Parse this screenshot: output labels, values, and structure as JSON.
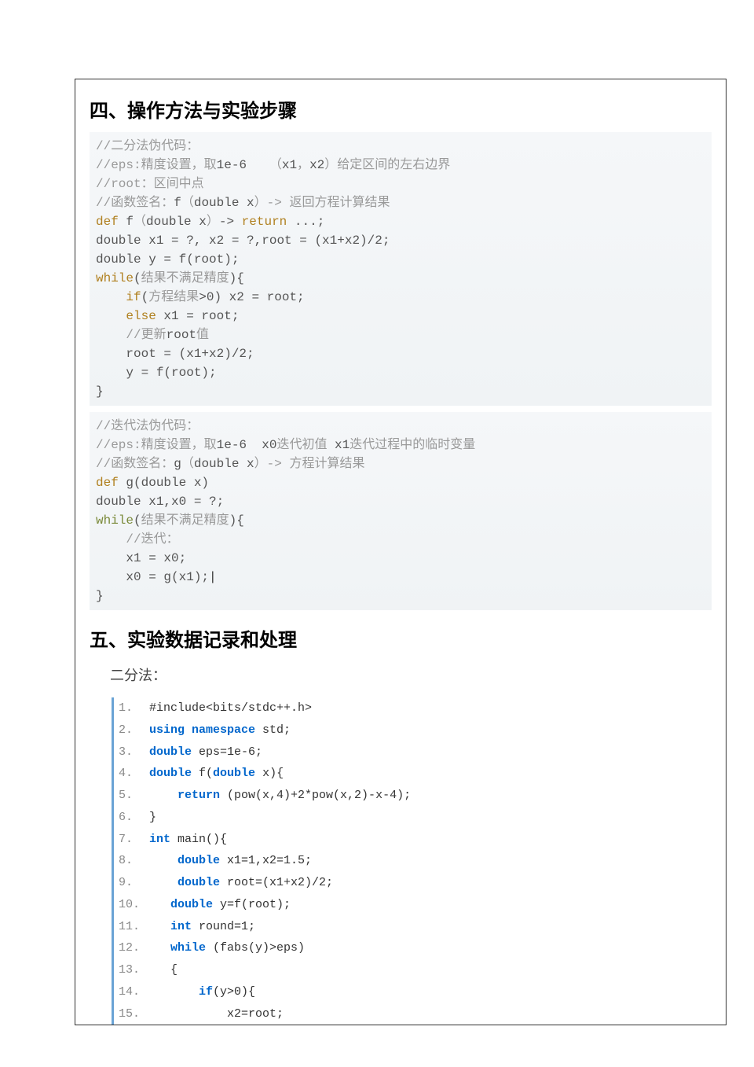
{
  "section4": {
    "heading": "四、操作方法与实验步骤",
    "codeBlock1": [
      {
        "t": "comment",
        "text": "//二分法伪代码："
      },
      {
        "t": "mixed",
        "parts": [
          {
            "c": "comment",
            "s": "//eps:精度设置，取"
          },
          {
            "c": "plain",
            "s": "1e-6"
          },
          {
            "c": "comment",
            "s": "   （"
          },
          {
            "c": "plain",
            "s": "x1"
          },
          {
            "c": "comment",
            "s": "，"
          },
          {
            "c": "plain",
            "s": "x2"
          },
          {
            "c": "comment",
            "s": "）给定区间的左右边界"
          }
        ]
      },
      {
        "t": "mixed",
        "parts": [
          {
            "c": "comment",
            "s": "//root"
          },
          {
            "c": "comment",
            "s": "：区间中点"
          }
        ]
      },
      {
        "t": "mixed",
        "parts": [
          {
            "c": "comment",
            "s": "//函数签名："
          },
          {
            "c": "plain",
            "s": "f"
          },
          {
            "c": "comment",
            "s": "（"
          },
          {
            "c": "plain",
            "s": "double x"
          },
          {
            "c": "comment",
            "s": "）-> 返回方程计算结果"
          }
        ]
      },
      {
        "t": "mixed",
        "parts": [
          {
            "c": "keyword",
            "s": "def "
          },
          {
            "c": "plain",
            "s": "f"
          },
          {
            "c": "comment",
            "s": "（"
          },
          {
            "c": "plain",
            "s": "double x"
          },
          {
            "c": "comment",
            "s": "）"
          },
          {
            "c": "plain",
            "s": "-> "
          },
          {
            "c": "keyword",
            "s": "return "
          },
          {
            "c": "plain",
            "s": "...;"
          }
        ]
      },
      {
        "t": "mixed",
        "parts": [
          {
            "c": "plain",
            "s": "double x1 = ?, x2 = ?,root = (x1+x2)/2;"
          }
        ]
      },
      {
        "t": "mixed",
        "parts": [
          {
            "c": "plain",
            "s": "double y = f(root);"
          }
        ]
      },
      {
        "t": "mixed",
        "parts": [
          {
            "c": "keyword",
            "s": "while"
          },
          {
            "c": "plain",
            "s": "("
          },
          {
            "c": "comment",
            "s": "结果不满足精度"
          },
          {
            "c": "plain",
            "s": "){"
          }
        ]
      },
      {
        "t": "mixed",
        "parts": [
          {
            "c": "plain",
            "s": "    "
          },
          {
            "c": "keyword",
            "s": "if"
          },
          {
            "c": "plain",
            "s": "("
          },
          {
            "c": "comment",
            "s": "方程结果"
          },
          {
            "c": "plain",
            "s": ">0) x2 = root;"
          }
        ]
      },
      {
        "t": "mixed",
        "parts": [
          {
            "c": "plain",
            "s": "    "
          },
          {
            "c": "keyword",
            "s": "else"
          },
          {
            "c": "plain",
            "s": " x1 = root;"
          }
        ]
      },
      {
        "t": "mixed",
        "parts": [
          {
            "c": "plain",
            "s": "    "
          },
          {
            "c": "comment",
            "s": "//更新"
          },
          {
            "c": "plain",
            "s": "root"
          },
          {
            "c": "comment",
            "s": "值"
          }
        ]
      },
      {
        "t": "mixed",
        "parts": [
          {
            "c": "plain",
            "s": "    root = (x1+x2)/2;"
          }
        ]
      },
      {
        "t": "mixed",
        "parts": [
          {
            "c": "plain",
            "s": "    y = f(root);"
          }
        ]
      },
      {
        "t": "mixed",
        "parts": [
          {
            "c": "plain",
            "s": "}"
          }
        ]
      }
    ],
    "codeBlock2": [
      {
        "t": "comment",
        "text": "//迭代法伪代码："
      },
      {
        "t": "mixed",
        "parts": [
          {
            "c": "comment",
            "s": "//eps:精度设置，取"
          },
          {
            "c": "plain",
            "s": "1e-6  x0"
          },
          {
            "c": "comment",
            "s": "迭代初值 "
          },
          {
            "c": "plain",
            "s": "x1"
          },
          {
            "c": "comment",
            "s": "迭代过程中的临时变量"
          }
        ]
      },
      {
        "t": "mixed",
        "parts": [
          {
            "c": "comment",
            "s": "//函数签名："
          },
          {
            "c": "plain",
            "s": "g"
          },
          {
            "c": "comment",
            "s": "（"
          },
          {
            "c": "plain",
            "s": "double x"
          },
          {
            "c": "comment",
            "s": "）-> 方程计算结果"
          }
        ]
      },
      {
        "t": "mixed",
        "parts": [
          {
            "c": "keyword",
            "s": "def "
          },
          {
            "c": "plain",
            "s": "g(double x)"
          }
        ]
      },
      {
        "t": "mixed",
        "parts": [
          {
            "c": "plain",
            "s": "double x1,x0 = ?;"
          }
        ]
      },
      {
        "t": "mixed",
        "parts": [
          {
            "c": "keyword2",
            "s": "while"
          },
          {
            "c": "plain",
            "s": "("
          },
          {
            "c": "comment",
            "s": "结果不满足精度"
          },
          {
            "c": "plain",
            "s": "){"
          }
        ]
      },
      {
        "t": "mixed",
        "parts": [
          {
            "c": "plain",
            "s": "    "
          },
          {
            "c": "comment",
            "s": "//迭代："
          }
        ]
      },
      {
        "t": "mixed",
        "parts": [
          {
            "c": "plain",
            "s": "    x1 = x0;"
          }
        ]
      },
      {
        "t": "mixed",
        "parts": [
          {
            "c": "plain",
            "s": "    x0 = g(x1);"
          },
          {
            "c": "cursor",
            "s": "|"
          }
        ]
      },
      {
        "t": "mixed",
        "parts": [
          {
            "c": "plain",
            "s": "}"
          }
        ]
      }
    ]
  },
  "section5": {
    "heading": "五、实验数据记录和处理",
    "subLabel": "二分法：",
    "codeLines": [
      {
        "num": "1.",
        "parts": [
          {
            "c": "plain",
            "s": " #include<bits/stdc++.h>"
          }
        ]
      },
      {
        "num": "2.",
        "parts": [
          {
            "c": "plain",
            "s": " "
          },
          {
            "c": "kw-blue",
            "s": "using namespace"
          },
          {
            "c": "plain",
            "s": " std;"
          }
        ]
      },
      {
        "num": "3.",
        "parts": [
          {
            "c": "plain",
            "s": " "
          },
          {
            "c": "kw-blue",
            "s": "double"
          },
          {
            "c": "plain",
            "s": " eps=1e-6;"
          }
        ]
      },
      {
        "num": "4.",
        "parts": [
          {
            "c": "plain",
            "s": " "
          },
          {
            "c": "kw-blue",
            "s": "double"
          },
          {
            "c": "plain",
            "s": " f("
          },
          {
            "c": "kw-blue",
            "s": "double"
          },
          {
            "c": "plain",
            "s": " x){"
          }
        ]
      },
      {
        "num": "5.",
        "parts": [
          {
            "c": "plain",
            "s": "     "
          },
          {
            "c": "kw-blue",
            "s": "return"
          },
          {
            "c": "plain",
            "s": " (pow(x,4)+2*pow(x,2)-x-4);"
          }
        ]
      },
      {
        "num": "6.",
        "parts": [
          {
            "c": "plain",
            "s": " }"
          }
        ]
      },
      {
        "num": "7.",
        "parts": [
          {
            "c": "plain",
            "s": " "
          },
          {
            "c": "kw-blue",
            "s": "int"
          },
          {
            "c": "plain",
            "s": " main(){"
          }
        ]
      },
      {
        "num": "8.",
        "parts": [
          {
            "c": "plain",
            "s": "     "
          },
          {
            "c": "kw-blue",
            "s": "double"
          },
          {
            "c": "plain",
            "s": " x1=1,x2=1.5;"
          }
        ]
      },
      {
        "num": "9.",
        "parts": [
          {
            "c": "plain",
            "s": "     "
          },
          {
            "c": "kw-blue",
            "s": "double"
          },
          {
            "c": "plain",
            "s": " root=(x1+x2)/2;"
          }
        ]
      },
      {
        "num": "10.",
        "parts": [
          {
            "c": "plain",
            "s": "    "
          },
          {
            "c": "kw-blue",
            "s": "double"
          },
          {
            "c": "plain",
            "s": " y=f(root);"
          }
        ]
      },
      {
        "num": "11.",
        "parts": [
          {
            "c": "plain",
            "s": "    "
          },
          {
            "c": "kw-blue",
            "s": "int"
          },
          {
            "c": "plain",
            "s": " round=1;"
          }
        ]
      },
      {
        "num": "12.",
        "parts": [
          {
            "c": "plain",
            "s": "    "
          },
          {
            "c": "kw-blue",
            "s": "while"
          },
          {
            "c": "plain",
            "s": " (fabs(y)>eps)"
          }
        ]
      },
      {
        "num": "13.",
        "parts": [
          {
            "c": "plain",
            "s": "    {"
          }
        ]
      },
      {
        "num": "14.",
        "parts": [
          {
            "c": "plain",
            "s": "        "
          },
          {
            "c": "kw-blue",
            "s": "if"
          },
          {
            "c": "plain",
            "s": "(y>0){"
          }
        ]
      },
      {
        "num": "15.",
        "parts": [
          {
            "c": "plain",
            "s": "            x2=root;"
          }
        ]
      }
    ]
  }
}
